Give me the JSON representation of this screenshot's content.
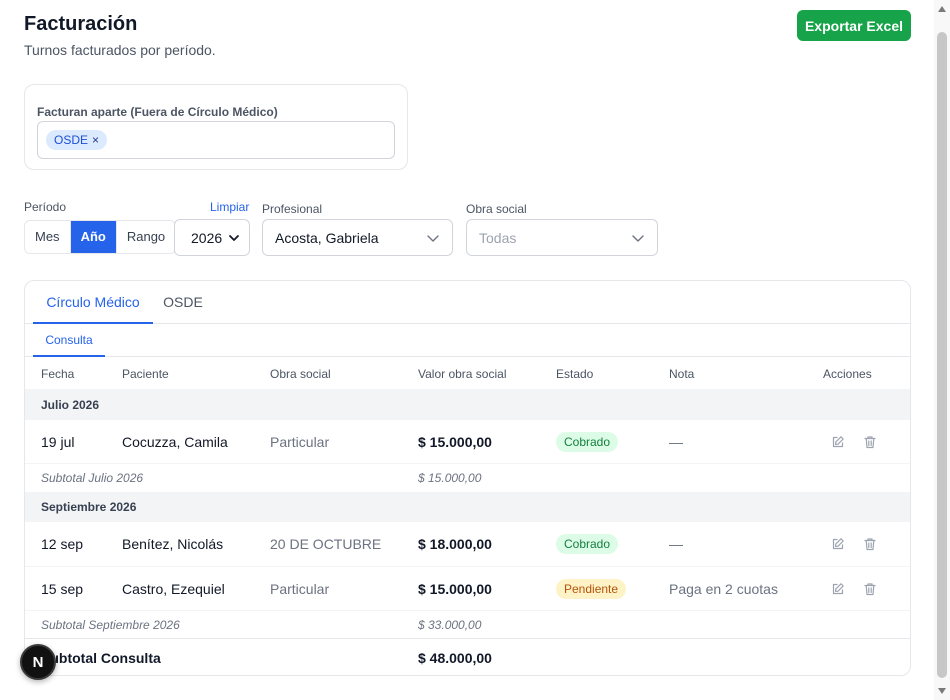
{
  "header": {
    "title": "Facturación",
    "subtitle": "Turnos facturados por período.",
    "export_label": "Exportar Excel"
  },
  "exclusion": {
    "label": "Facturan aparte (Fuera de Círculo Médico)",
    "chips": [
      "OSDE"
    ],
    "chip_remove": "×"
  },
  "filters": {
    "period_label": "Período",
    "clear_label": "Limpiar",
    "period_options": [
      "Mes",
      "Año",
      "Rango"
    ],
    "period_active": "Año",
    "year_value": "2026",
    "professional_label": "Profesional",
    "professional_value": "Acosta, Gabriela",
    "insurance_label": "Obra social",
    "insurance_placeholder": "Todas"
  },
  "tabs": [
    {
      "label": "Círculo Médico",
      "active": true
    },
    {
      "label": "OSDE",
      "active": false
    }
  ],
  "subtabs": [
    {
      "label": "Consulta",
      "active": true
    }
  ],
  "table": {
    "columns": [
      "Fecha",
      "Paciente",
      "Obra social",
      "Valor obra social",
      "Estado",
      "Nota",
      "Acciones"
    ],
    "groups": [
      {
        "label": "Julio 2026",
        "rows": [
          {
            "date": "19 jul",
            "patient": "Cocuzza, Camila",
            "insurance": "Particular",
            "value": "$ 15.000,00",
            "status": "Cobrado",
            "status_type": "ok",
            "note": "—"
          }
        ],
        "subtotal_label": "Subtotal Julio 2026",
        "subtotal_value": "$ 15.000,00"
      },
      {
        "label": "Septiembre 2026",
        "rows": [
          {
            "date": "12 sep",
            "patient": "Benítez, Nicolás",
            "insurance": "20 DE OCTUBRE",
            "value": "$ 18.000,00",
            "status": "Cobrado",
            "status_type": "ok",
            "note": "—"
          },
          {
            "date": "15 sep",
            "patient": "Castro, Ezequiel",
            "insurance": "Particular",
            "value": "$ 15.000,00",
            "status": "Pendiente",
            "status_type": "pend",
            "note": "Paga en 2 cuotas"
          }
        ],
        "subtotal_label": "Subtotal Septiembre 2026",
        "subtotal_value": "$ 33.000,00"
      }
    ],
    "total_label": "Subtotal Consulta",
    "total_value": "$ 48.000,00"
  },
  "floating_badge": {
    "label": "N"
  },
  "colors": {
    "accent": "#2563eb",
    "export": "#16a34a",
    "status_ok_bg": "#dcfce7",
    "status_ok_text": "#15803d",
    "status_pend_bg": "#fef3c7",
    "status_pend_text": "#b45309"
  },
  "icons": {
    "edit": "pencil-square-icon",
    "delete": "trash-icon",
    "select": "chevron-down-icon"
  }
}
